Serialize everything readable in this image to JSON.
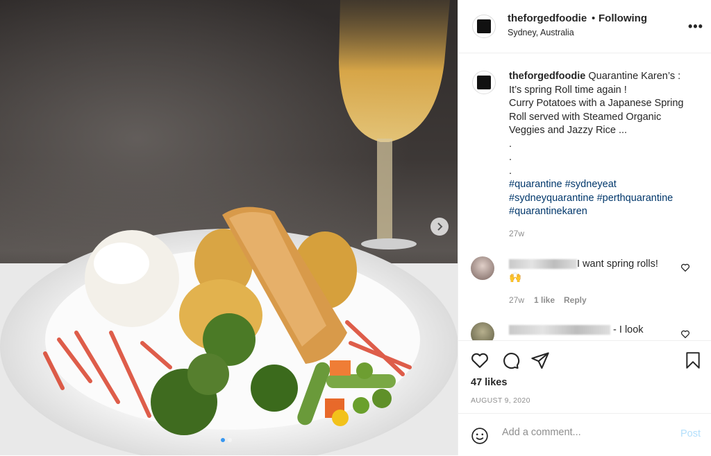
{
  "post": {
    "username": "theforgedfoodie",
    "following_sep": "•",
    "following": "Following",
    "location": "Sydney, Australia",
    "more": "•••"
  },
  "caption": {
    "username": "theforgedfoodie",
    "lines": [
      "Quarantine Karen’s :",
      "It’s spring Roll time again !",
      "Curry Potatoes with a Japanese Spring",
      "Roll served with Steamed Organic",
      "Veggies and Jazzy Rice ...",
      ".",
      ".",
      "."
    ],
    "hashtags": [
      "#quarantine #sydneyeat",
      "#sydneyquarantine #perthquarantine",
      "#quarantinekaren"
    ],
    "time": "27w"
  },
  "comments": [
    {
      "text": "I want spring rolls!",
      "emoji": "🙌",
      "time": "27w",
      "likes": "1 like",
      "reply": "Reply"
    },
    {
      "text": "- I look"
    }
  ],
  "actions": {
    "likes": "47 likes",
    "date": "AUGUST 9, 2020"
  },
  "add_comment": {
    "placeholder": "Add a comment...",
    "post": "Post"
  },
  "icons": {
    "like": "heart-icon",
    "comment": "comment-icon",
    "share": "paper-plane-icon",
    "save": "bookmark-icon",
    "emoji": "smiley-icon",
    "next": "chevron-right-icon"
  },
  "carousel": {
    "slides": 2,
    "active": 1
  },
  "colors": {
    "link": "#00376b",
    "post_disabled": "#b2dffc",
    "muted": "#8e8e8e",
    "accent": "#3897f0"
  }
}
